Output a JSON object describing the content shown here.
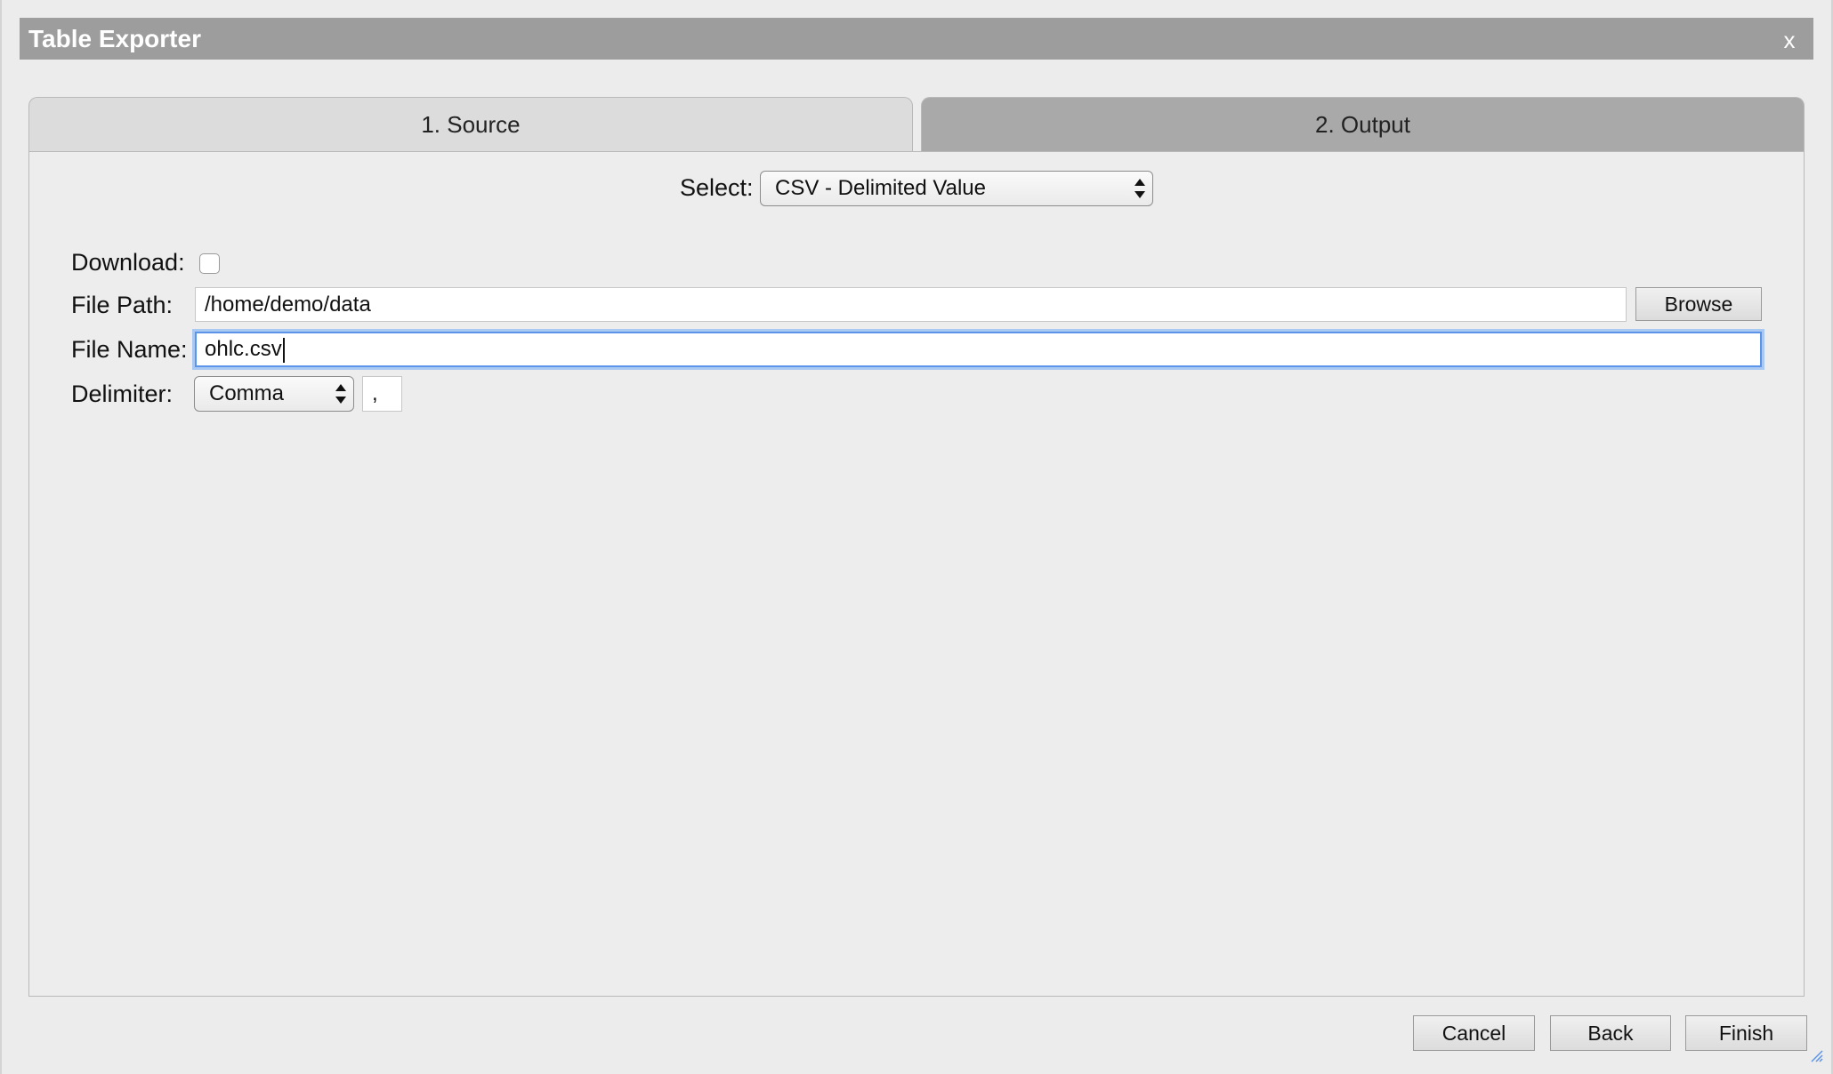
{
  "title_bar": {
    "title": "Table Exporter",
    "close_label": "x"
  },
  "tabs": [
    {
      "label": "1. Source"
    },
    {
      "label": "2. Output"
    }
  ],
  "output": {
    "select_label": "Select:",
    "select_value": "CSV - Delimited Value",
    "download_label": "Download:",
    "download_checked": false,
    "file_path_label": "File Path:",
    "file_path_value": "/home/demo/data",
    "browse_label": "Browse",
    "file_name_label": "File Name:",
    "file_name_value": "ohlc.csv",
    "delimiter_label": "Delimiter:",
    "delimiter_select_value": "Comma",
    "delimiter_char": ","
  },
  "footer": {
    "cancel_label": "Cancel",
    "back_label": "Back",
    "finish_label": "Finish"
  },
  "colors": {
    "title_bar": "#9d9d9d",
    "active_tab": "#a9a9a9",
    "inactive_tab": "#dcdcdc",
    "focus_ring": "#5b94e8"
  }
}
